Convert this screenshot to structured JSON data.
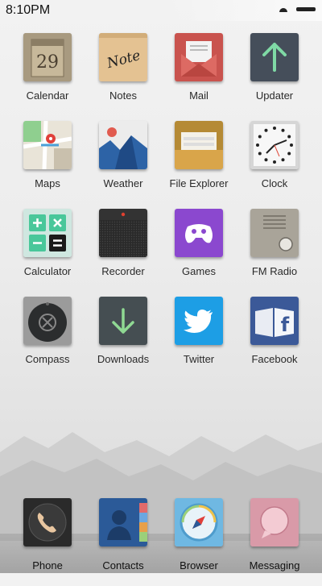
{
  "status": {
    "time": "8:10PM"
  },
  "apps": [
    {
      "id": "calendar",
      "label": "Calendar",
      "text": "29"
    },
    {
      "id": "notes",
      "label": "Notes",
      "text": "Note"
    },
    {
      "id": "mail",
      "label": "Mail"
    },
    {
      "id": "updater",
      "label": "Updater"
    },
    {
      "id": "maps",
      "label": "Maps"
    },
    {
      "id": "weather",
      "label": "Weather"
    },
    {
      "id": "file-explorer",
      "label": "File Explorer"
    },
    {
      "id": "clock",
      "label": "Clock"
    },
    {
      "id": "calculator",
      "label": "Calculator"
    },
    {
      "id": "recorder",
      "label": "Recorder"
    },
    {
      "id": "games",
      "label": "Games"
    },
    {
      "id": "fm-radio",
      "label": "FM Radio"
    },
    {
      "id": "compass",
      "label": "Compass"
    },
    {
      "id": "downloads",
      "label": "Downloads"
    },
    {
      "id": "twitter",
      "label": "Twitter"
    },
    {
      "id": "facebook",
      "label": "Facebook",
      "text": "f"
    }
  ],
  "dock": [
    {
      "id": "phone",
      "label": "Phone"
    },
    {
      "id": "contacts",
      "label": "Contacts"
    },
    {
      "id": "browser",
      "label": "Browser"
    },
    {
      "id": "messaging",
      "label": "Messaging"
    }
  ]
}
